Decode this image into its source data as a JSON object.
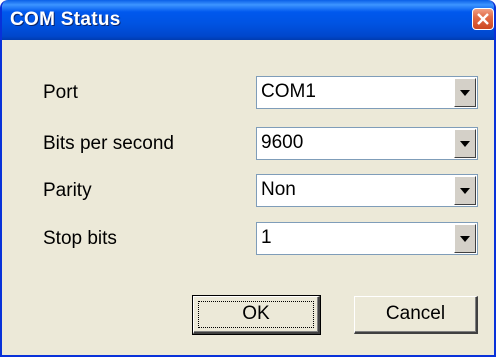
{
  "window": {
    "title": "COM Status",
    "close_icon": "close-icon"
  },
  "fields": [
    {
      "label": "Port",
      "value": "COM1"
    },
    {
      "label": "Bits per second",
      "value": "9600"
    },
    {
      "label": "Parity",
      "value": "Non"
    },
    {
      "label": "Stop bits",
      "value": "1"
    }
  ],
  "buttons": {
    "ok": "OK",
    "cancel": "Cancel"
  },
  "colors": {
    "titlebar": "#0054e3",
    "close": "#e26c48",
    "dialog_bg": "#ece9d8"
  }
}
